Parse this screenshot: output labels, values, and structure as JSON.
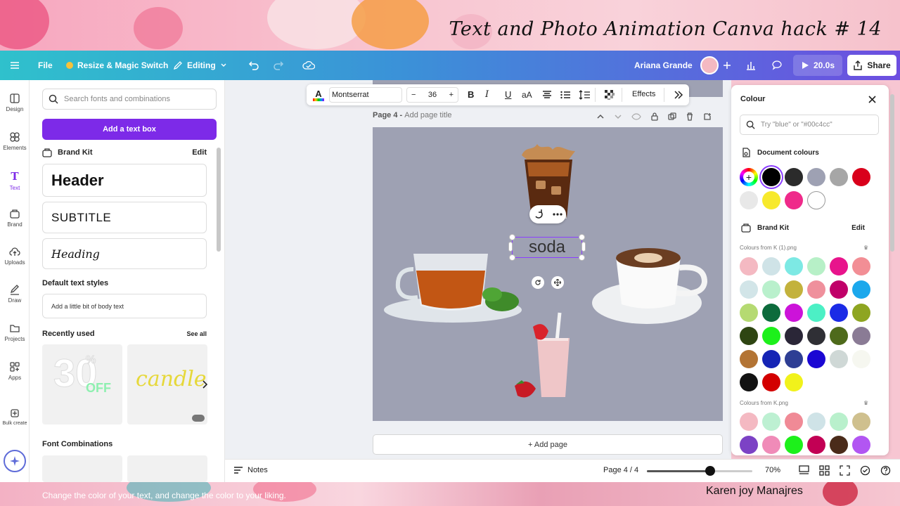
{
  "banner": {
    "title": "Text and Photo Animation Canva hack # 14"
  },
  "topbar": {
    "file": "File",
    "resize": "Resize & Magic Switch",
    "editing": "Editing",
    "user": "Ariana Grande",
    "duration": "20.0s",
    "share": "Share"
  },
  "rail": {
    "items": [
      "Design",
      "Elements",
      "Text",
      "Brand",
      "Uploads",
      "Draw",
      "Projects",
      "Apps",
      "Bulk create"
    ]
  },
  "panel": {
    "search_placeholder": "Search fonts and combinations",
    "add_text": "Add a text box",
    "brand_kit": "Brand Kit",
    "brand_edit": "Edit",
    "header": "Header",
    "subtitle": "SUBTITLE",
    "heading": "Heading",
    "default_styles": "Default text styles",
    "body_text": "Add a little bit of body text",
    "recently_used": "Recently used",
    "see_all": "See all",
    "thumb1_num": "30",
    "thumb1_pct": "%",
    "thumb1_off": "OFF",
    "thumb2": "candle",
    "font_combinations": "Font Combinations"
  },
  "toolbar": {
    "font": "Montserrat",
    "size": "36",
    "effects": "Effects"
  },
  "canvas": {
    "page_label": "Page 4 - ",
    "page_title_placeholder": "Add page title",
    "text_element": "soda",
    "add_page": "+ Add page"
  },
  "colour": {
    "title": "Colour",
    "search_placeholder": "Try \"blue\" or \"#00c4cc\"",
    "document_colours": "Document colours",
    "brand_kit": "Brand Kit",
    "brand_edit": "Edit",
    "from1": "Colours from K (1).png",
    "from2": "Colours from K.png",
    "doc_swatches": [
      "#000000",
      "#2b2b2b",
      "#9ea1b3",
      "#a6a6a6",
      "#d9001b",
      "#e8e8e8",
      "#f7e92c",
      "#ef2a8a",
      "#ffffff"
    ],
    "kit1": [
      "#f4b9c2",
      "#cfe3e7",
      "#7de9e4",
      "#b7f0c7",
      "#e8148c",
      "#f28e95",
      "#d2e5e8",
      "#b9f0cc",
      "#c3b23c",
      "#ef909c",
      "#c00069",
      "#1ba8ec",
      "#b5da72",
      "#0d6b3c",
      "#cc13d9",
      "#4cf0c5",
      "#1b2be6",
      "#8ea521",
      "#2e4512",
      "#1df01b",
      "#2a2637",
      "#2f2f35",
      "#4e6a1b",
      "#8a7b95",
      "#b37434",
      "#1524b5",
      "#2e3e94",
      "#1b07d3",
      "#cfd8d6",
      "#f6f7f0",
      "#121212",
      "#d30000",
      "#f1f21b"
    ],
    "kit2": [
      "#f4b9c2",
      "#bdf0d2",
      "#f08a96",
      "#cfe3e7",
      "#b9f0cc",
      "#cfc08e",
      "#7c42c5",
      "#f08bb8",
      "#1df01b",
      "#c20054",
      "#4a2b1a",
      "#b256f2"
    ]
  },
  "bottombar": {
    "notes": "Notes",
    "page_count": "Page 4 / 4",
    "zoom": "70%",
    "zoom_level": 0.6
  },
  "footer": {
    "caption": "Change the color of your text,  and change the color to your liking.",
    "credit": "Karen joy Manajres"
  }
}
